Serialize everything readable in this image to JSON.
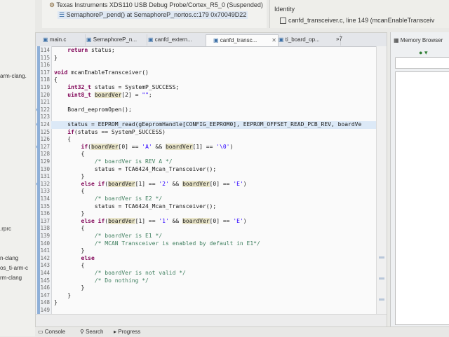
{
  "debug": {
    "line1": "Texas Instruments XDS110 USB Debug Probe/Cortex_R5_0 (Suspended)",
    "line2": "SemaphoreP_pend() at SemaphoreP_nortos.c:179 0x70049D22"
  },
  "identity": {
    "title": "Identity",
    "row": "canfd_transceiver.c, line 149 (mcanEnableTransceiv"
  },
  "left_strip": [
    "arm-clang.",
    ".rprc",
    "n-clang",
    "os_ti-arm-c",
    "rm-clang"
  ],
  "tabs": [
    {
      "label": "main.c",
      "active": false
    },
    {
      "label": "SemaphoreP_n...",
      "active": false
    },
    {
      "label": "canfd_extern...",
      "active": false
    },
    {
      "label": "canfd_transc...",
      "active": true
    },
    {
      "label": "ti_board_op...",
      "active": false
    }
  ],
  "tabs_overflow": "»7",
  "code_lines": [
    {
      "n": "114",
      "t": "    return status;"
    },
    {
      "n": "115",
      "t": "}"
    },
    {
      "n": "116",
      "t": ""
    },
    {
      "n": "117",
      "t": "void mcanEnableTransceiver()"
    },
    {
      "n": "118",
      "t": "{"
    },
    {
      "n": "119",
      "t": "    int32_t status = SystemP_SUCCESS;"
    },
    {
      "n": "120",
      "t": "    uint8_t boardVer[2] = \"\";"
    },
    {
      "n": "121",
      "t": ""
    },
    {
      "n": "122",
      "t": "    Board_eepromOpen();"
    },
    {
      "n": "123",
      "t": ""
    },
    {
      "n": "124",
      "t": "    status = EEPROM_read(gEepromHandle[CONFIG_EEPROM0], EEPROM_OFFSET_READ_PCB_REV, boardVe"
    },
    {
      "n": "125",
      "t": "    if(status == SystemP_SUCCESS)"
    },
    {
      "n": "126",
      "t": "    {"
    },
    {
      "n": "127",
      "t": "        if(boardVer[0] == 'A' && boardVer[1] == '\\0')"
    },
    {
      "n": "128",
      "t": "        {"
    },
    {
      "n": "129",
      "t": "            /* boardVer is REV A */"
    },
    {
      "n": "130",
      "t": "            status = TCA6424_Mcan_Transceiver();"
    },
    {
      "n": "131",
      "t": "        }"
    },
    {
      "n": "132",
      "t": "        else if(boardVer[1] == '2' && boardVer[0] == 'E')"
    },
    {
      "n": "133",
      "t": "        {"
    },
    {
      "n": "134",
      "t": "            /* boardVer is E2 */"
    },
    {
      "n": "135",
      "t": "            status = TCA6424_Mcan_Transceiver();"
    },
    {
      "n": "136",
      "t": "        }"
    },
    {
      "n": "137",
      "t": "        else if(boardVer[1] == '1' && boardVer[0] == 'E')"
    },
    {
      "n": "138",
      "t": "        {"
    },
    {
      "n": "139",
      "t": "            /* boardVer is E1 */"
    },
    {
      "n": "140",
      "t": "            /* MCAN Transceiver is enabled by default in E1*/"
    },
    {
      "n": "141",
      "t": "        }"
    },
    {
      "n": "142",
      "t": "        else"
    },
    {
      "n": "143",
      "t": "        {"
    },
    {
      "n": "144",
      "t": "            /* boardVer is not valid */"
    },
    {
      "n": "145",
      "t": "            /* Do nothing */"
    },
    {
      "n": "146",
      "t": "        }"
    },
    {
      "n": "147",
      "t": "    }"
    },
    {
      "n": "148",
      "t": "}"
    },
    {
      "n": "149",
      "t": ""
    }
  ],
  "memory": {
    "tab_label": "Memory Browser"
  },
  "bottom": {
    "console": "Console",
    "search": "Search",
    "progress": "Progress"
  }
}
